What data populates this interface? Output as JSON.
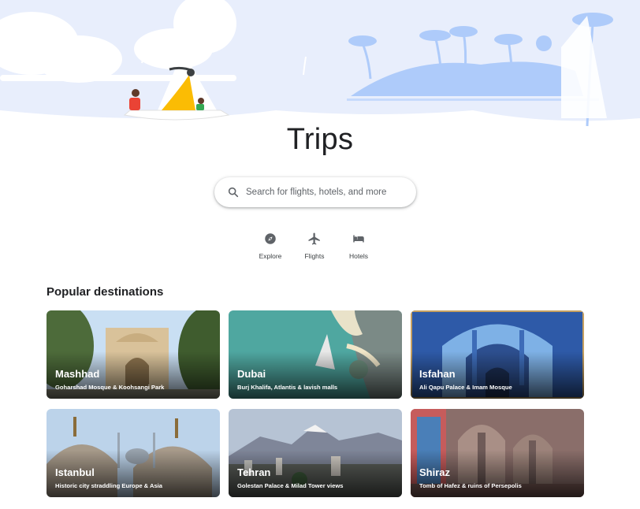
{
  "page": {
    "title": "Trips"
  },
  "search": {
    "placeholder": "Search for flights, hotels, and more"
  },
  "nav": [
    {
      "label": "Explore",
      "icon": "compass-icon"
    },
    {
      "label": "Flights",
      "icon": "airplane-icon"
    },
    {
      "label": "Hotels",
      "icon": "bed-icon"
    }
  ],
  "popular": {
    "title": "Popular destinations",
    "destinations": [
      {
        "name": "Mashhad",
        "description": "Goharshad Mosque & Koohsangi Park"
      },
      {
        "name": "Dubai",
        "description": "Burj Khalifa, Atlantis & lavish malls"
      },
      {
        "name": "Isfahan",
        "description": "Ali Qapu Palace & Imam Mosque"
      },
      {
        "name": "Istanbul",
        "description": "Historic city straddling Europe & Asia"
      },
      {
        "name": "Tehran",
        "description": "Golestan Palace & Milad Tower views"
      },
      {
        "name": "Shiraz",
        "description": "Tomb of Hafez & ruins of Persepolis"
      }
    ]
  },
  "colors": {
    "hero_sky": "#e8eefc",
    "hero_island": "#aecbfa",
    "text_primary": "#202124",
    "icon_gray": "#5f6368"
  }
}
